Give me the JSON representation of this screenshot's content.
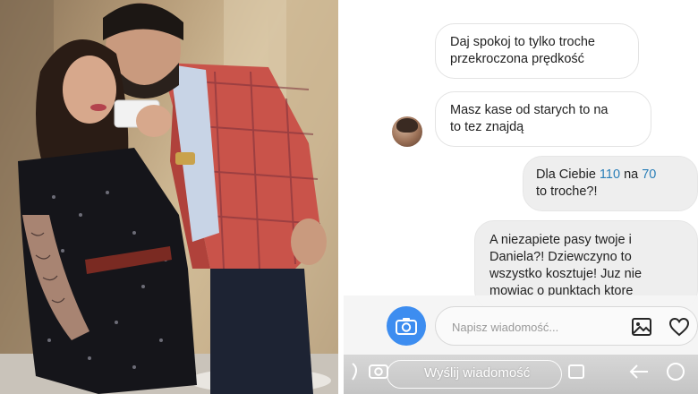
{
  "messages": [
    {
      "direction": "received",
      "text": "Daj spokoj to tylko troche\nprzekroczona prędkość"
    },
    {
      "direction": "received",
      "text": "Masz kase od starych to na\nto tez znajdą"
    },
    {
      "direction": "sent",
      "text_before": "Dla Ciebie ",
      "n1": "110",
      "mid": " na ",
      "n2": "70",
      "text_after": "to troche?!"
    },
    {
      "direction": "sent",
      "text": "A niezapiete pasy twoje i\nDaniela?! Dziewczyno to\nwszystko kosztuje! Juz nie\nmowiac o punktach ktore"
    }
  ],
  "composer": {
    "placeholder": "Napisz wiadomość..."
  },
  "story_reply": {
    "label": "Wyślij wiadomość"
  },
  "colors": {
    "accent_blue": "#3d8df0",
    "highlight_number": "#2a7fb8",
    "sent_bubble": "#eeeeee",
    "received_bubble_border": "#e3e3e3"
  },
  "icons": [
    "camera-icon",
    "gallery-icon",
    "heart-icon",
    "more-icon",
    "share-icon",
    "back-arrow-icon"
  ]
}
